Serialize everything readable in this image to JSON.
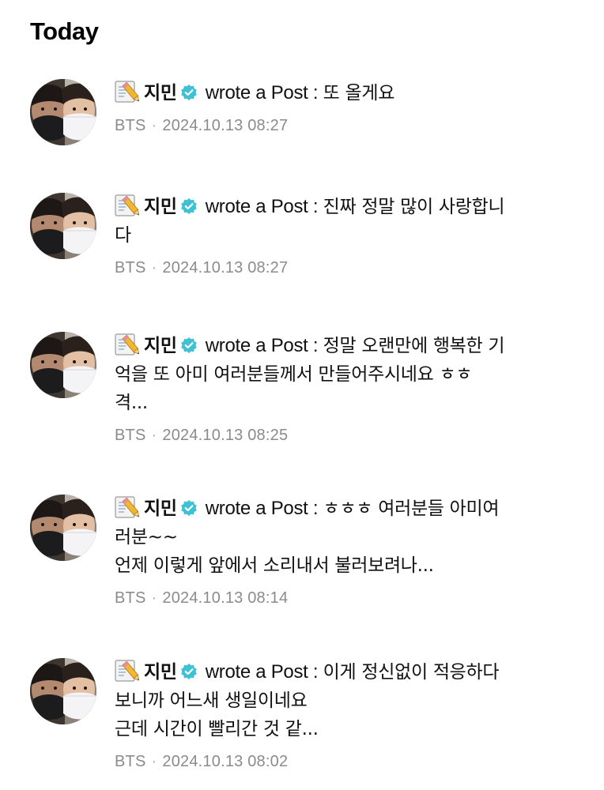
{
  "section_title": "Today",
  "action_prefix": "wrote a Post : ",
  "colors": {
    "verified": "#3fc1d4",
    "meta_text": "#8b8b8b"
  },
  "icons": {
    "post_type": "memo-pencil-icon",
    "verified": "verified-check-icon"
  },
  "posts": [
    {
      "author": "지민",
      "lines": [
        "또 올게요"
      ],
      "source": "BTS",
      "separator": "·",
      "timestamp": "2024.10.13 08:27"
    },
    {
      "author": "지민",
      "lines": [
        "진짜 정말 많이 사랑합니",
        "다"
      ],
      "source": "BTS",
      "separator": "·",
      "timestamp": "2024.10.13 08:27"
    },
    {
      "author": "지민",
      "lines": [
        "정말 오랜만에 행복한 기",
        "억을 또 아미 여러분들께서 만들어주시네요 ㅎㅎ",
        "격..."
      ],
      "source": "BTS",
      "separator": "·",
      "timestamp": "2024.10.13 08:25"
    },
    {
      "author": "지민",
      "lines": [
        "ㅎㅎㅎ 여러분들 아미여",
        "러분~~",
        "언제 이렇게 앞에서 소리내서 불러보려나..."
      ],
      "source": "BTS",
      "separator": "·",
      "timestamp": "2024.10.13 08:14"
    },
    {
      "author": "지민",
      "lines": [
        "이게 정신없이 적응하다",
        "보니까 어느새 생일이네요",
        "근데 시간이 빨리간 것 같..."
      ],
      "source": "BTS",
      "separator": "·",
      "timestamp": "2024.10.13 08:02"
    }
  ]
}
